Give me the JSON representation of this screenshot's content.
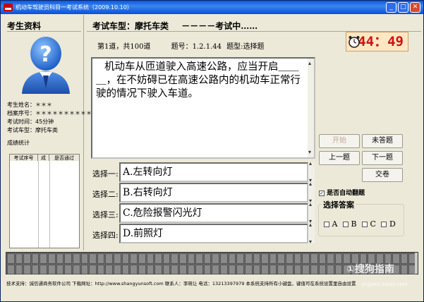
{
  "window": {
    "title": "机动车驾驶员科目一考试系统（2009.10.10）"
  },
  "candidate": {
    "header": "考生资料",
    "fields": [
      {
        "label": "考生姓名：",
        "value": "＊＊＊"
      },
      {
        "label": "档案序号：",
        "value": "＊＊＊＊＊＊＊＊＊＊＊＊＊"
      },
      {
        "label": "考试时间：",
        "value": "45分钟"
      },
      {
        "label": "考试车型：",
        "value": "摩托车类"
      }
    ],
    "score_title": "成绩统计",
    "score_columns": [
      "考试序号",
      "成",
      "是否通过"
    ]
  },
  "exam": {
    "car_type_label": "考试车型：",
    "car_type": "摩托车类",
    "status": "－－－－考试中……",
    "question_no": "第1道，共100道",
    "question_id": "题号：1.2.1.44",
    "question_type": "题型:选择题",
    "timer": "44：49",
    "question_text": "机动车从匝道驶入高速公路，应当开启＿＿＿，在不妨碍已在高速公路内的机动车正常行驶的情况下驶入车道。"
  },
  "options": [
    {
      "label": "选择一:",
      "text": "A.左转向灯"
    },
    {
      "label": "选择二:",
      "text": "B.右转向灯"
    },
    {
      "label": "选择三:",
      "text": "C.危险报警闪光灯"
    },
    {
      "label": "选择四:",
      "text": "D.前照灯"
    }
  ],
  "buttons": {
    "start": "开始",
    "unanswered": "未答题",
    "prev": "上一题",
    "next": "下一题",
    "submit": "交卷"
  },
  "auto_flip": {
    "label": "是否自动翻题",
    "checked": true
  },
  "answer": {
    "title": "选择答案",
    "choices": [
      "A",
      "B",
      "C",
      "D"
    ]
  },
  "footer": {
    "text": "技术支持：诚信通商务软件公司  下载网址：http://www.shangyunsoft.com  联系人：李晓让  电话：13213397979  本系统支持所有小键盘，键值可在系统设置里自由设置"
  },
  "watermark": {
    "text": "①搜狗指南",
    "url": "jingyan.baidu.com"
  },
  "colors": {
    "timer": "#d01010",
    "titlebar": "#0a5ae0"
  }
}
